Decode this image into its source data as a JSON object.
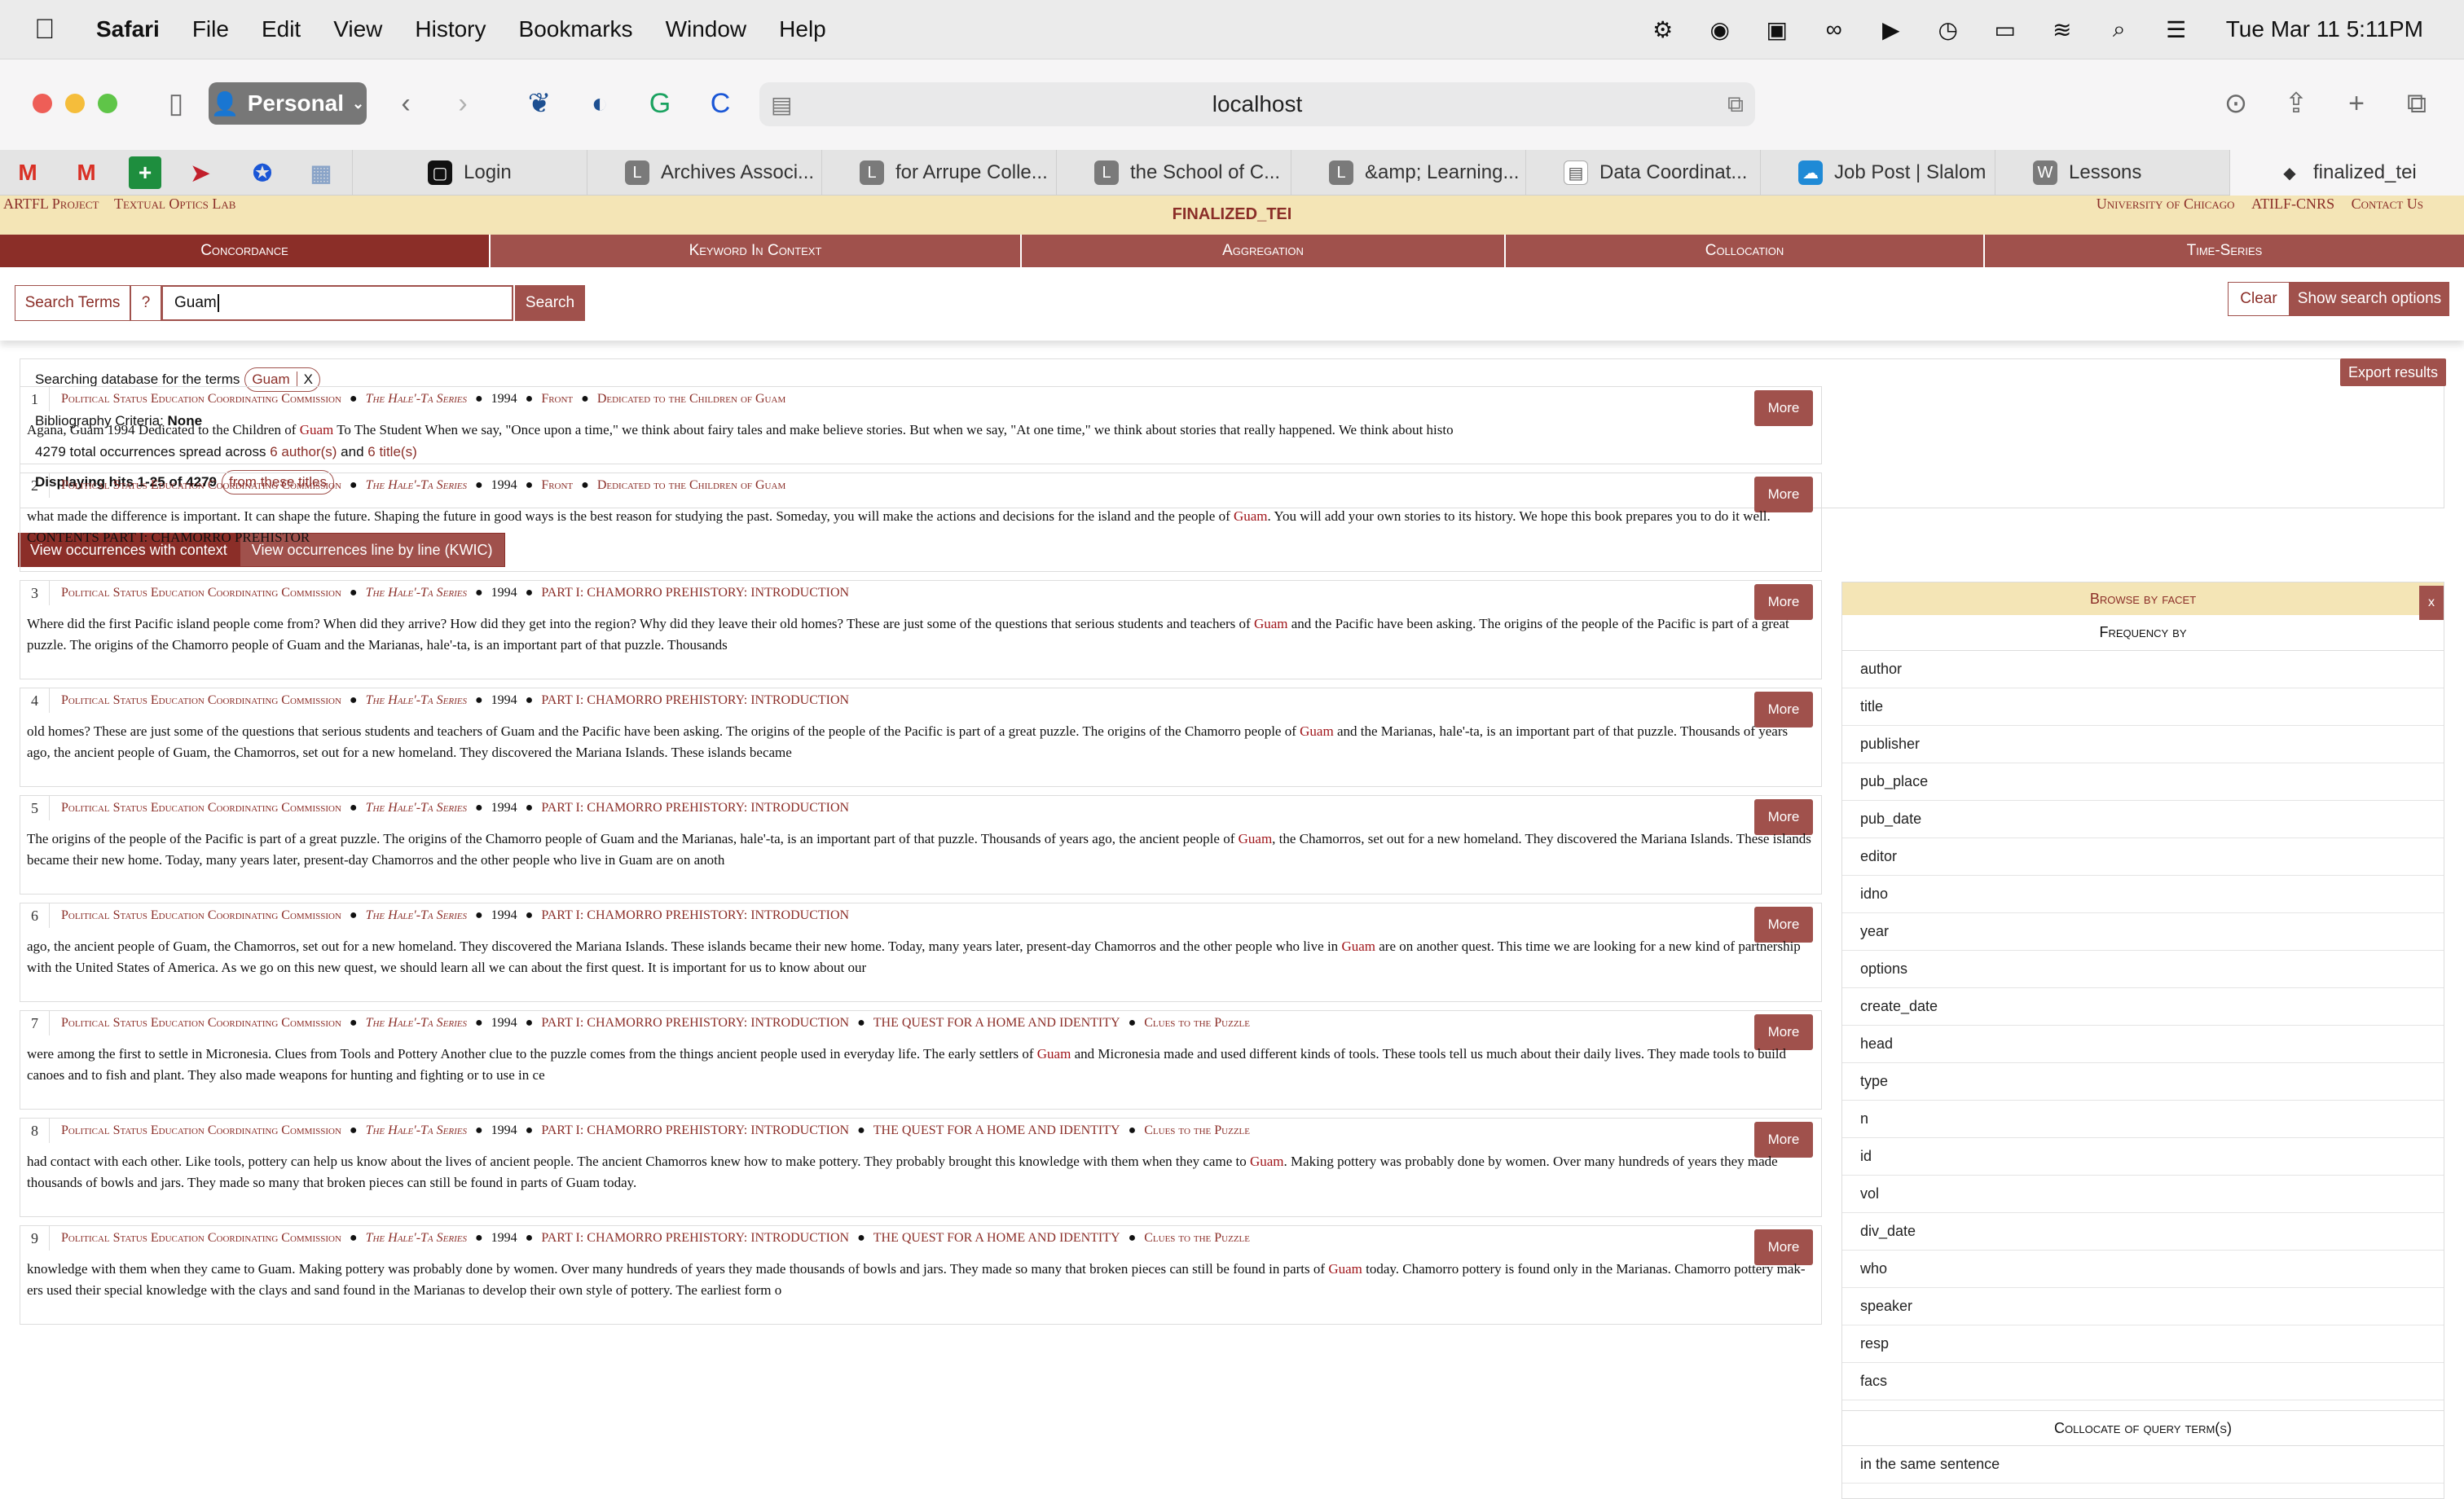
{
  "menubar": {
    "app": "Safari",
    "items": [
      "File",
      "Edit",
      "View",
      "History",
      "Bookmarks",
      "Window",
      "Help"
    ],
    "clock": "Tue Mar 11  5:11PM"
  },
  "browser": {
    "profile": "Personal",
    "url": "localhost",
    "tabs": [
      {
        "icon": "▢",
        "label": "Login"
      },
      {
        "icon": "L",
        "label": "Archives Associ..."
      },
      {
        "icon": "L",
        "label": "for Arrupe Colle..."
      },
      {
        "icon": "L",
        "label": "the School of C..."
      },
      {
        "icon": "L",
        "label": "&amp; Learning..."
      },
      {
        "icon": "▤",
        "label": "Data Coordinat..."
      },
      {
        "icon": "☁",
        "label": "Job Post | Slalom"
      },
      {
        "icon": "W",
        "label": "Lessons"
      },
      {
        "icon": "◆",
        "label": "finalized_tei"
      }
    ]
  },
  "site": {
    "left_links": [
      "ARTFL Project",
      "Textual Optics Lab"
    ],
    "title": "FINALIZED_TEI",
    "right_links": [
      "University of Chicago",
      "ATILF-CNRS",
      "Contact Us"
    ],
    "nav": [
      "Concordance",
      "Keyword In Context",
      "Aggregation",
      "Collocation",
      "Time-Series"
    ]
  },
  "search": {
    "terms_label": "Search Terms",
    "help": "?",
    "value": "Guam",
    "search_button": "Search",
    "clear_button": "Clear",
    "options_button": "Show search options"
  },
  "summary": {
    "searching_prefix": "Searching database for the terms",
    "term": "Guam",
    "term_remove": "X",
    "biblio_label": "Bibliography Criteria:",
    "biblio_value": "None",
    "occ_prefix": "4279 total occurrences spread across",
    "authors": "6 author(s)",
    "and": "and",
    "titles": "6 title(s)",
    "displaying": "Displaying hits 1-25 of 4279",
    "from_titles": "from these titles",
    "export": "Export results"
  },
  "view": {
    "context": "View occurrences with context",
    "kwic": "View occurrences line by line (KWIC)"
  },
  "results": [
    {
      "n": "1",
      "author": "Political Status Education Coordinating Commission",
      "series": "The Hale'-Ta Series",
      "year": "1994",
      "sections": [
        {
          "t": "Front",
          "sc": true
        },
        {
          "t": "Dedicated to the Children of Guam",
          "sc": true
        }
      ],
      "before": "Agana, Guam 1994 Dedicated to the Children of ",
      "hit": "Guam",
      "after": " To The Student When we say, \"Once upon a time,\" we think about fairy tales and make believe stories. But when we say, \"At one time,\" we think about stories that really happened. We think about histo"
    },
    {
      "n": "2",
      "author": "Political Status Education Coordinating Commission",
      "series": "The Hale'-Ta Series",
      "year": "1994",
      "sections": [
        {
          "t": "Front",
          "sc": true
        },
        {
          "t": "Dedicated to the Children of Guam",
          "sc": true
        }
      ],
      "before": "what made the difference is important. It can shape the future. Shaping the future in good ways is the best reason for studying the past. Someday, you will make the actions and decisions for the island and the people of ",
      "hit": "Guam",
      "after": ". You will add your own stories to its history. We hope this book prepares you to do it well. CONTENTS PART I: CHAMORRO PREHISTOR"
    },
    {
      "n": "3",
      "author": "Political Status Education Coordinating Commission",
      "series": "The Hale'-Ta Series",
      "year": "1994",
      "sections": [
        {
          "t": "PART I: CHAMORRO PREHISTORY: INTRODUCTION",
          "sc": false
        }
      ],
      "before": "Where did the first Pacific island people come from? When did they arrive? How did they get into the region? Why did they leave their old homes? These are just some of the questions that serious students and teachers of ",
      "hit": "Guam",
      "after": " and the Pacific have been asking. The origins of the people of the Pacific is part of a great puzzle. The origins of the Chamorro people of Guam and the Marianas, hale'-ta, is an important part of that puzzle. Thousands"
    },
    {
      "n": "4",
      "author": "Political Status Education Coordinating Commission",
      "series": "The Hale'-Ta Series",
      "year": "1994",
      "sections": [
        {
          "t": "PART I: CHAMORRO PREHISTORY: INTRODUCTION",
          "sc": false
        }
      ],
      "before": "old homes? These are just some of the questions that serious students and teachers of Guam and the Pacific have been asking. The origins of the people of the Pacific is part of a great puzzle. The origins of the Chamorro people of ",
      "hit": "Guam",
      "after": " and the Marianas, hale'-ta, is an important part of that puzzle. Thousands of years ago, the ancient people of Guam, the Chamorros, set out for a new homeland. They discovered the Mariana Islands. These islands became"
    },
    {
      "n": "5",
      "author": "Political Status Education Coordinating Commission",
      "series": "The Hale'-Ta Series",
      "year": "1994",
      "sections": [
        {
          "t": "PART I: CHAMORRO PREHISTORY: INTRODUCTION",
          "sc": false
        }
      ],
      "before": "The origins of the people of the Pacific is part of a great puzzle. The origins of the Chamorro people of Guam and the Marianas, hale'-ta, is an important part of that puzzle. Thousands of years ago, the ancient people of ",
      "hit": "Guam",
      "after": ", the Chamorros, set out for a new homeland. They discovered the Mariana Islands. These islands became their new home. Today, many years later, present-day Chamorros and the other people who live in Guam are on anoth"
    },
    {
      "n": "6",
      "author": "Political Status Education Coordinating Commission",
      "series": "The Hale'-Ta Series",
      "year": "1994",
      "sections": [
        {
          "t": "PART I: CHAMORRO PREHISTORY: INTRODUCTION",
          "sc": false
        }
      ],
      "before": "ago, the ancient people of Guam, the Chamorros, set out for a new homeland. They discovered the Mariana Islands. These islands became their new home. Today, many years later, present-day Chamorros and the other people who live in ",
      "hit": "Guam",
      "after": " are on another quest. This time we are looking for a new kind of partnership with the United States of America. As we go on this new quest, we should learn all we can about the first quest. It is important for us to know about our"
    },
    {
      "n": "7",
      "author": "Political Status Education Coordinating Commission",
      "series": "The Hale'-Ta Series",
      "year": "1994",
      "sections": [
        {
          "t": "PART I: CHAMORRO PREHISTORY: INTRODUCTION",
          "sc": false
        },
        {
          "t": "THE QUEST FOR A HOME AND IDENTITY",
          "sc": false
        },
        {
          "t": "Clues to the Puzzle",
          "sc": true
        }
      ],
      "before": "were among the first to settle in Micronesia. Clues from Tools and Pottery Another clue to the puzzle comes from the things ancient people used in everyday life. The early settlers of ",
      "hit": "Guam",
      "after": " and Micronesia made and used different kinds of tools. These tools tell us much about their daily lives. They made tools to build canoes and to fish and plant. They also made weapons for hunting and fighting or to use in ce"
    },
    {
      "n": "8",
      "author": "Political Status Education Coordinating Commission",
      "series": "The Hale'-Ta Series",
      "year": "1994",
      "sections": [
        {
          "t": "PART I: CHAMORRO PREHISTORY: INTRODUCTION",
          "sc": false
        },
        {
          "t": "THE QUEST FOR A HOME AND IDENTITY",
          "sc": false
        },
        {
          "t": "Clues to the Puzzle",
          "sc": true
        }
      ],
      "before": "had contact with each other. Like tools, pottery can help us know about the lives of ancient people. The ancient Chamorros knew how to make pottery. They probably brought this knowledge with them when they came to ",
      "hit": "Guam",
      "after": ". Making pottery was probably done by women. Over many hundreds of years they made thousands of bowls and jars. They made so many that broken pieces can still be found in parts of Guam today."
    },
    {
      "n": "9",
      "author": "Political Status Education Coordinating Commission",
      "series": "The Hale'-Ta Series",
      "year": "1994",
      "sections": [
        {
          "t": "PART I: CHAMORRO PREHISTORY: INTRODUCTION",
          "sc": false
        },
        {
          "t": "THE QUEST FOR A HOME AND IDENTITY",
          "sc": false
        },
        {
          "t": "Clues to the Puzzle",
          "sc": true
        }
      ],
      "before": "knowledge with them when they came to Guam. Making pottery was probably done by women. Over many hundreds of years they made thousands of bowls and jars. They made so many that broken pieces can still be found in parts of ",
      "hit": "Guam",
      "after": " today. Chamorro pottery is found only in the Marianas. Chamorro pottery mak- ers used their special knowledge with the clays and sand found in the Marianas to develop their own style of pottery. The earliest form o"
    }
  ],
  "more_label": "More",
  "facets": {
    "header": "Browse by facet",
    "close": "x",
    "freq_label": "Frequency by",
    "items": [
      "author",
      "title",
      "publisher",
      "pub_place",
      "pub_date",
      "editor",
      "idno",
      "year",
      "options",
      "create_date",
      "head",
      "type",
      "n",
      "id",
      "vol",
      "div_date",
      "who",
      "speaker",
      "resp",
      "facs"
    ],
    "collocate_label": "Collocate of query term(s)",
    "collocate_item": "in the same sentence"
  }
}
